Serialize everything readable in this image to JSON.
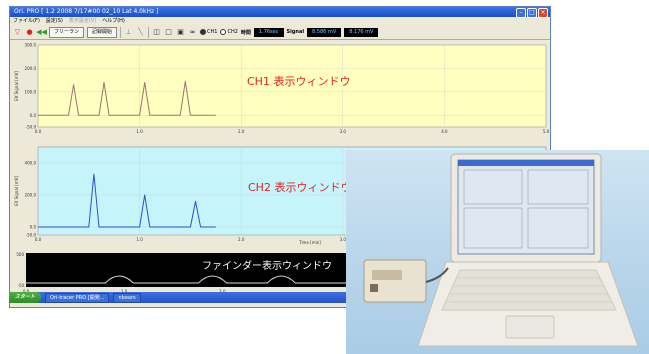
{
  "app": {
    "title": "Ori. PRO [ 1.2 2008 7/17#00 02_10 Lat 4.0kHz ]",
    "window_buttons": [
      "minimize-icon",
      "maximize-icon",
      "close-icon"
    ]
  },
  "menu": {
    "items": [
      "ファイル(F)",
      "設定(S)",
      "表示設定(V)",
      "ヘルプ(H)"
    ]
  },
  "toolbar": {
    "freeze_label": "フリーラン",
    "record_label": "記録開始",
    "ch1_label": "CH1",
    "ch2_label": "CH2",
    "time_label": "時間",
    "time_value": "1.76sec",
    "signal_label": "Signal",
    "signal_value_1": "8.586 mV",
    "signal_value_2": "8.176 mV"
  },
  "panels": {
    "ch1_label": "CH1 表示ウィンドウ",
    "ch2_label": "CH2 表示ウィンドウ",
    "finder_label": "ファインダー表示ウィンドウ",
    "ch1_ylabel": "EV Signal [mV]",
    "ch2_ylabel": "EX Signal [mV]",
    "time_axis_label": "Time [min]"
  },
  "colors": {
    "ch1_bg": "#ffffbf",
    "ch2_bg": "#c5f4fb",
    "ch1_trace": "#a07070",
    "ch2_trace": "#2f4fc8",
    "finder_bg": "#000000",
    "label_red": "#e52222"
  },
  "chart_data": [
    {
      "type": "line",
      "name": "CH1",
      "x_ticks": [
        "0.0",
        "1.0",
        "2.0",
        "3.0",
        "4.0",
        "5.0"
      ],
      "y_ticks": [
        "300.0",
        "200.0",
        "100.0",
        "0.0",
        "-50.0"
      ],
      "xlim": [
        0,
        5
      ],
      "ylim": [
        -50,
        300
      ],
      "x": [
        0.0,
        0.2,
        0.3,
        0.35,
        0.4,
        0.5,
        0.6,
        0.65,
        0.7,
        0.8,
        1.0,
        1.05,
        1.1,
        1.2,
        1.4,
        1.45,
        1.5,
        1.6,
        1.75
      ],
      "y": [
        0,
        0,
        0,
        130,
        0,
        0,
        0,
        140,
        0,
        0,
        0,
        140,
        0,
        0,
        0,
        145,
        0,
        0,
        0
      ]
    },
    {
      "type": "line",
      "name": "CH2",
      "x_ticks": [
        "0.0",
        "1.0",
        "2.0",
        "3.0"
      ],
      "y_ticks": [
        "200.0",
        "400.0",
        "0.0",
        "-50.0"
      ],
      "xlim": [
        0,
        5
      ],
      "ylim": [
        -50,
        500
      ],
      "x": [
        0.0,
        0.3,
        0.5,
        0.55,
        0.6,
        0.8,
        1.0,
        1.05,
        1.1,
        1.3,
        1.5,
        1.55,
        1.6,
        1.75
      ],
      "y": [
        0,
        0,
        0,
        330,
        0,
        0,
        0,
        200,
        0,
        0,
        0,
        160,
        0,
        0
      ]
    },
    {
      "type": "line",
      "name": "Finder",
      "x_ticks": [
        "0.0",
        "1.0",
        "2.0"
      ],
      "y_ticks": [
        "500",
        "-50"
      ],
      "xlim": [
        0,
        3.3
      ],
      "ylim": [
        -50,
        500
      ]
    }
  ],
  "taskbar": {
    "start_label": "スタート",
    "items": [
      "Ori-tracer PRO [開発...",
      "nbears"
    ]
  }
}
